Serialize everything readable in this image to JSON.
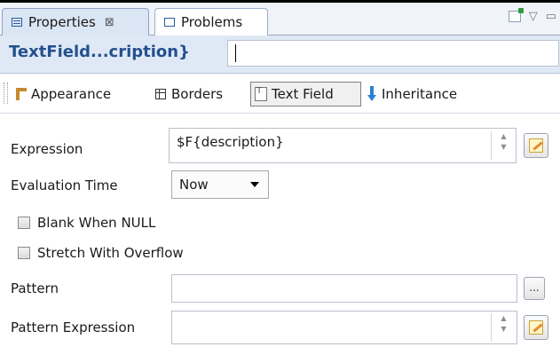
{
  "tabs": [
    {
      "label": "Properties",
      "close_glyph": "⊠",
      "icon": "properties-icon"
    },
    {
      "label": "Problems",
      "icon": "problems-icon"
    }
  ],
  "view_tools": {
    "menu_glyph": "▽",
    "minimize_glyph": "▭"
  },
  "element_title": "TextField...cription}",
  "name_value": "",
  "sections": [
    {
      "label": "Appearance",
      "icon": "appearance-icon"
    },
    {
      "label": "Borders",
      "icon": "borders-icon"
    },
    {
      "label": "Text Field",
      "icon": "text-field-icon",
      "selected": true
    },
    {
      "label": "Inheritance",
      "icon": "inheritance-icon"
    }
  ],
  "form": {
    "expression_label": "Expression",
    "expression_value": "$F{description}",
    "evaluation_time_label": "Evaluation Time",
    "evaluation_time_value": "Now",
    "blank_when_null_label": "Blank When NULL",
    "blank_when_null_checked": false,
    "stretch_with_overflow_label": "Stretch With Overflow",
    "stretch_with_overflow_checked": false,
    "pattern_label": "Pattern",
    "pattern_value": "",
    "pattern_button_label": "...",
    "pattern_expression_label": "Pattern Expression",
    "pattern_expression_value": ""
  },
  "colors": {
    "title_text": "#25508e",
    "active_tab": "#dbe6f5",
    "title_bar": "#dfe9f6"
  }
}
